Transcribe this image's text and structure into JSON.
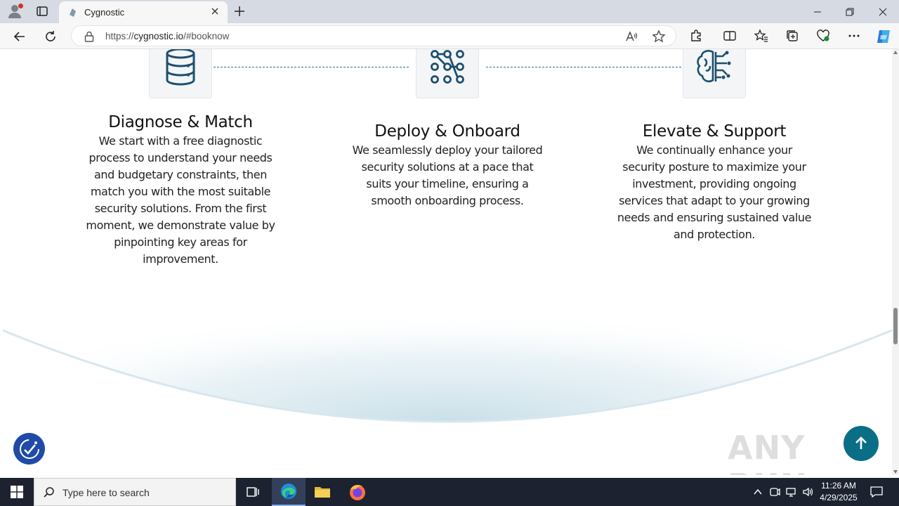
{
  "browser": {
    "tab_title": "Cygnostic",
    "url_prefix": "https://",
    "url_domain": "cygnostic.io",
    "url_path": "/#booknow"
  },
  "steps": [
    {
      "icon": "database-icon",
      "title": "Diagnose & Match",
      "description": "We start with a free diagnostic process to understand your needs and budgetary constraints, then match you with the most suitable security solutions. From the first moment, we demonstrate value by pinpointing key areas for improvement."
    },
    {
      "icon": "network-nodes-icon",
      "title": "Deploy & Onboard",
      "description": "We seamlessly deploy your tailored security solutions at a pace that suits your timeline, ensuring a smooth onboarding process."
    },
    {
      "icon": "brain-circuit-icon",
      "title": "Elevate & Support",
      "description": "We continually enhance your security posture to maximize your investment, providing ongoing services that adapt to your growing needs and ensuring sustained value and protection."
    }
  ],
  "watermark": "ANY RUN",
  "taskbar": {
    "search_placeholder": "Type here to search",
    "time": "11:26 AM",
    "date": "4/29/2025"
  },
  "colors": {
    "accent": "#0a6e87",
    "accessibility": "#1f4aa8",
    "icon_stroke": "#1d4f6e"
  }
}
